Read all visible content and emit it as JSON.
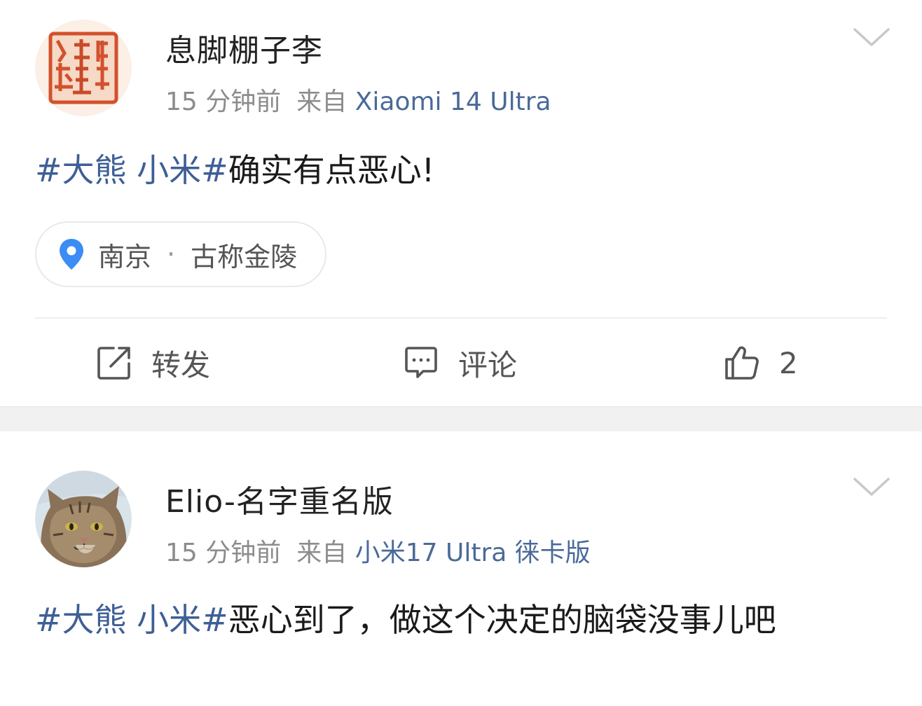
{
  "posts": [
    {
      "username": "息脚棚子李",
      "time": "15 分钟前",
      "source_prefix": "来自",
      "device": "Xiaomi 14 Ultra",
      "topic": "#大熊 小米#",
      "text": "确实有点恶心!",
      "location": {
        "city": "南京",
        "dot": "·",
        "detail": "古称金陵"
      },
      "actions": {
        "repost_label": "转发",
        "comment_label": "评论",
        "like_count": "2"
      }
    },
    {
      "username": "Elio-名字重名版",
      "time": "15 分钟前",
      "source_prefix": "来自",
      "device": "小米17 Ultra 徕卡版",
      "topic": "#大熊 小米#",
      "text": "恶心到了，做这个决定的脑袋没事儿吧"
    }
  ],
  "colors": {
    "topic_link": "#3e5f96",
    "device_link": "#4a6a98",
    "meta_gray": "#8c8c8c",
    "pin_blue": "#3b8cf5",
    "separator": "#f1f1f1"
  },
  "icons": {
    "menu": "chevron-down-icon",
    "location": "location-pin-icon",
    "repost": "share-arrow-icon",
    "comment": "comment-bubble-icon",
    "like": "thumbs-up-icon"
  }
}
